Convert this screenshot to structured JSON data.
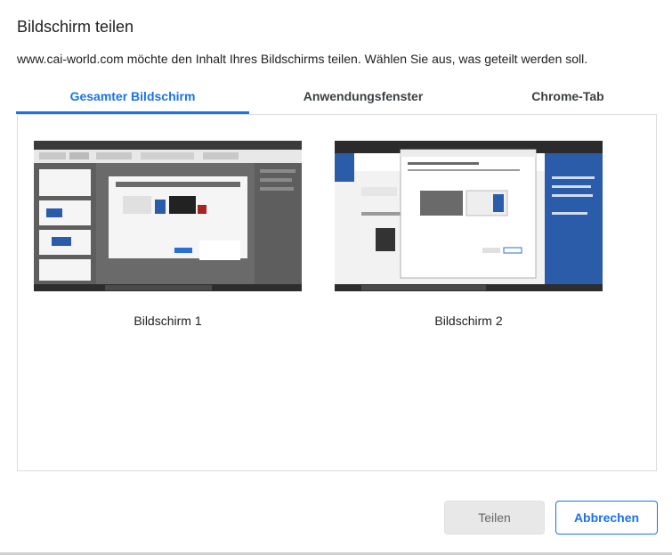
{
  "dialog": {
    "title": "Bildschirm teilen",
    "description": "www.cai-world.com möchte den Inhalt Ihres Bildschirms teilen. Wählen Sie aus, was geteilt werden soll."
  },
  "tabs": [
    {
      "label": "Gesamter Bildschirm",
      "active": true
    },
    {
      "label": "Anwendungsfenster",
      "active": false
    },
    {
      "label": "Chrome-Tab",
      "active": false
    }
  ],
  "screens": [
    {
      "label": "Bildschirm 1"
    },
    {
      "label": "Bildschirm 2"
    }
  ],
  "buttons": {
    "share_label": "Teilen",
    "cancel_label": "Abbrechen"
  },
  "colors": {
    "accent": "#1a73e8",
    "disabled_bg": "#e8e8e8"
  }
}
